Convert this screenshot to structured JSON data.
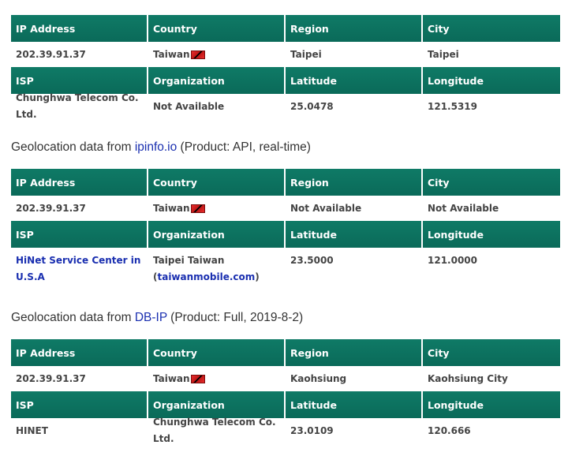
{
  "tables": [
    {
      "header1": [
        "IP Address",
        "Country",
        "Region",
        "City"
      ],
      "row1": {
        "ip": "202.39.91.37",
        "country": "Taiwan",
        "region": "Taipei",
        "city": "Taipei"
      },
      "header2": [
        "ISP",
        "Organization",
        "Latitude",
        "Longitude"
      ],
      "row2": {
        "isp": "Chunghwa Telecom Co. Ltd.",
        "org": "Not Available",
        "lat": "25.0478",
        "lon": "121.5319"
      }
    },
    {
      "caption": {
        "prefix": "Geolocation data from ",
        "source": "ipinfo.io",
        "suffix": " (Product: API, real-time)"
      },
      "header1": [
        "IP Address",
        "Country",
        "Region",
        "City"
      ],
      "row1": {
        "ip": "202.39.91.37",
        "country": "Taiwan",
        "region": "Not Available",
        "city": "Not Available"
      },
      "header2": [
        "ISP",
        "Organization",
        "Latitude",
        "Longitude"
      ],
      "row2": {
        "isp_line1": "HiNet Service Center in",
        "isp_line2": "U.S.A",
        "org_line1": "Taipei Taiwan",
        "org_paren_open": "(",
        "org_link": "taiwanmobile.com",
        "org_paren_close": ")",
        "lat": "23.5000",
        "lon": "121.0000"
      }
    },
    {
      "caption": {
        "prefix": "Geolocation data from ",
        "source": "DB-IP",
        "suffix": " (Product: Full, 2019-8-2)"
      },
      "header1": [
        "IP Address",
        "Country",
        "Region",
        "City"
      ],
      "row1": {
        "ip": "202.39.91.37",
        "country": "Taiwan",
        "region": "Kaohsiung",
        "city": "Kaohsiung City"
      },
      "header2": [
        "ISP",
        "Organization",
        "Latitude",
        "Longitude"
      ],
      "row2": {
        "isp": "HINET",
        "org": "Chunghwa Telecom Co. Ltd.",
        "lat": "23.0109",
        "lon": "120.666"
      }
    }
  ],
  "colors": {
    "header_bg": "#0a6a59",
    "link": "#1a2fb0",
    "text": "#444444"
  },
  "icons": {
    "flag": "taiwan-flag-icon"
  }
}
